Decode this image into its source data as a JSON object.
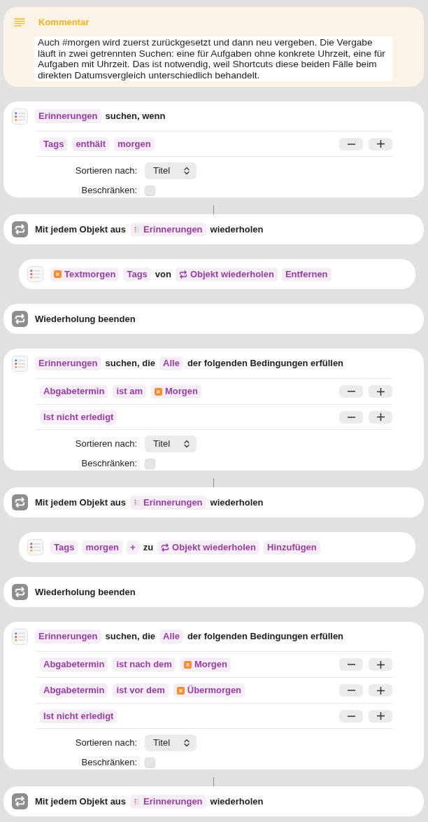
{
  "actions": [
    {
      "kind": "comment",
      "title": "Kommentar",
      "text": "Auch #morgen wird zuerst zurückgesetzt und dann neu vergeben. Die Vergabe läuft in zwei getrennten Suchen: eine für Aufgaben ohne konkrete Uhrzeit, eine für Aufgaben mit Uhrzeit. Das ist notwendig, weil Shortcuts diese beiden Fälle beim direkten Datumsvergleich unterschiedlich behandelt."
    },
    {
      "kind": "find",
      "parts": [
        {
          "kind": "token",
          "text": "Erinnerungen"
        },
        {
          "kind": "text",
          "text": "suchen, wenn"
        }
      ],
      "conditions": [
        {
          "parts": [
            {
              "kind": "token",
              "text": "Tags"
            },
            {
              "kind": "token",
              "text": "enthält"
            },
            {
              "kind": "token",
              "text": "morgen"
            }
          ]
        }
      ],
      "sort": {
        "label": "Sortieren nach:",
        "value": "Titel"
      },
      "limit": {
        "label": "Beschränken:",
        "checked": false
      }
    },
    {
      "kind": "repeat",
      "parts": [
        {
          "kind": "text",
          "text": "Mit jedem Objekt aus"
        },
        {
          "kind": "list",
          "text": "Erinnerungen"
        },
        {
          "kind": "text",
          "text": "wiederholen"
        }
      ],
      "children": [
        {
          "kind": "action",
          "parts": [
            {
              "kind": "variable",
              "text": "Textmorgen"
            },
            {
              "kind": "token",
              "text": "Tags"
            },
            {
              "kind": "text",
              "text": "von"
            },
            {
              "kind": "loop_item",
              "text": "Objekt wiederholen"
            },
            {
              "kind": "token",
              "text": "Entfernen"
            }
          ]
        }
      ]
    },
    {
      "kind": "end_repeat",
      "parts": [
        {
          "kind": "text",
          "text": "Wiederholung beenden"
        }
      ]
    },
    {
      "kind": "find",
      "parts": [
        {
          "kind": "token",
          "text": "Erinnerungen"
        },
        {
          "kind": "text",
          "text": "suchen, die"
        },
        {
          "kind": "token",
          "text": "Alle"
        },
        {
          "kind": "text",
          "text": "der folgenden Bedingungen erfüllen"
        }
      ],
      "conditions": [
        {
          "parts": [
            {
              "kind": "token",
              "text": "Abgabetermin"
            },
            {
              "kind": "token",
              "text": "ist am"
            },
            {
              "kind": "variable",
              "text": "Morgen"
            }
          ]
        },
        {
          "parts": [
            {
              "kind": "token",
              "text": "Ist nicht erledigt"
            }
          ]
        }
      ],
      "sort": {
        "label": "Sortieren nach:",
        "value": "Titel"
      },
      "limit": {
        "label": "Beschränken:",
        "checked": false
      }
    },
    {
      "kind": "repeat",
      "parts": [
        {
          "kind": "text",
          "text": "Mit jedem Objekt aus"
        },
        {
          "kind": "list",
          "text": "Erinnerungen"
        },
        {
          "kind": "text",
          "text": "wiederholen"
        }
      ],
      "children": [
        {
          "kind": "action",
          "parts": [
            {
              "kind": "token",
              "text": "Tags"
            },
            {
              "kind": "token",
              "text": "morgen"
            },
            {
              "kind": "token",
              "text": "+"
            },
            {
              "kind": "text",
              "text": "zu"
            },
            {
              "kind": "loop_item",
              "text": "Objekt wiederholen"
            },
            {
              "kind": "token",
              "text": "Hinzufügen"
            }
          ]
        }
      ]
    },
    {
      "kind": "end_repeat",
      "parts": [
        {
          "kind": "text",
          "text": "Wiederholung beenden"
        }
      ]
    },
    {
      "kind": "find",
      "parts": [
        {
          "kind": "token",
          "text": "Erinnerungen"
        },
        {
          "kind": "text",
          "text": "suchen, die"
        },
        {
          "kind": "token",
          "text": "Alle"
        },
        {
          "kind": "text",
          "text": "der folgenden Bedingungen erfüllen"
        }
      ],
      "conditions": [
        {
          "parts": [
            {
              "kind": "token",
              "text": "Abgabetermin"
            },
            {
              "kind": "token",
              "text": "ist nach dem"
            },
            {
              "kind": "variable",
              "text": "Morgen"
            }
          ]
        },
        {
          "parts": [
            {
              "kind": "token",
              "text": "Abgabetermin"
            },
            {
              "kind": "token",
              "text": "ist vor dem"
            },
            {
              "kind": "variable",
              "text": "Übermorgen"
            }
          ]
        },
        {
          "parts": [
            {
              "kind": "token",
              "text": "Ist nicht erledigt"
            }
          ]
        }
      ],
      "sort": {
        "label": "Sortieren nach:",
        "value": "Titel"
      },
      "limit": {
        "label": "Beschränken:",
        "checked": false
      }
    },
    {
      "kind": "repeat",
      "parts": [
        {
          "kind": "text",
          "text": "Mit jedem Objekt aus"
        },
        {
          "kind": "list",
          "text": "Erinnerungen"
        },
        {
          "kind": "text",
          "text": "wiederholen"
        }
      ]
    }
  ]
}
